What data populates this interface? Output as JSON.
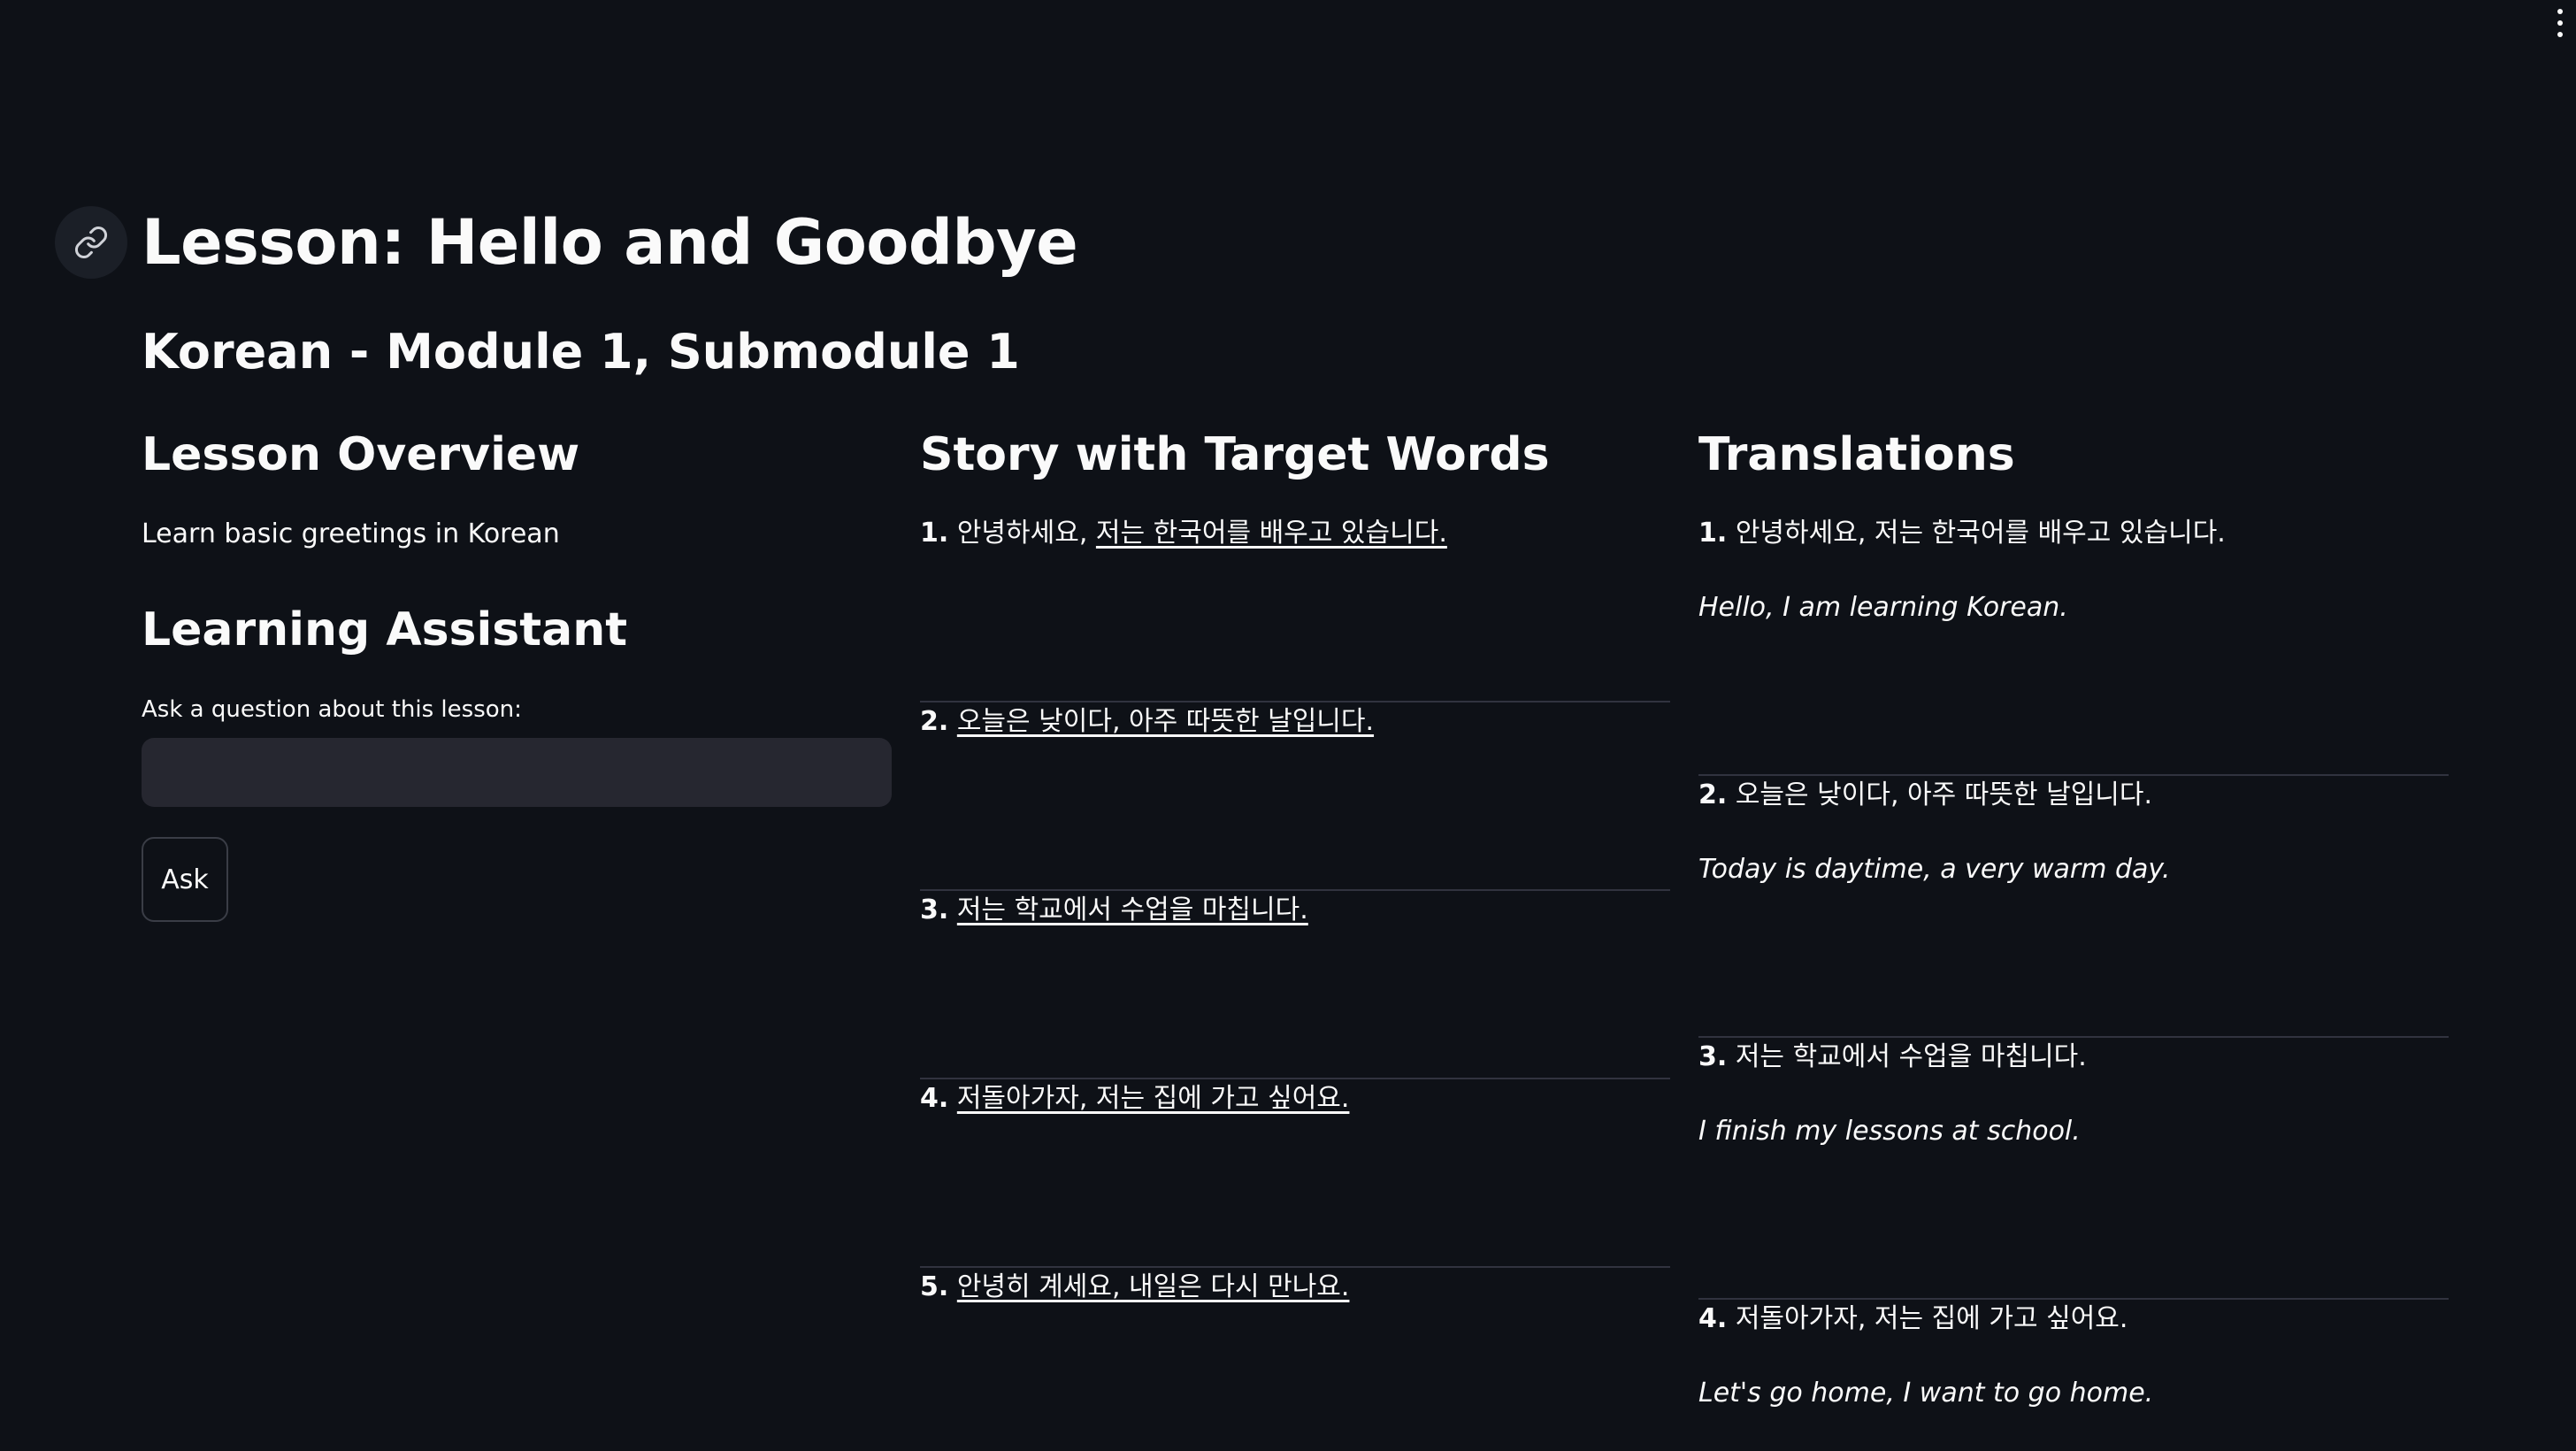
{
  "menu": {
    "icon": "vertical-ellipsis-icon"
  },
  "header": {
    "anchor_icon": "link-icon",
    "title": "Lesson: Hello and Goodbye",
    "subtitle": "Korean - Module 1, Submodule 1"
  },
  "overview": {
    "heading": "Lesson Overview",
    "text": "Learn basic greetings in Korean"
  },
  "assistant": {
    "heading": "Learning Assistant",
    "input_label": "Ask a question about this lesson:",
    "input_value": "",
    "button_label": "Ask"
  },
  "story": {
    "heading": "Story with Target Words",
    "items": [
      {
        "number": "1.",
        "plain": "안녕하세요, ",
        "underlined": "저는 한국어를 배우고 있습니다."
      },
      {
        "number": "2.",
        "plain": "",
        "underlined": "오늘은 낮이다, 아주 따뜻한 날입니다."
      },
      {
        "number": "3.",
        "plain": "",
        "underlined": "저는 학교에서 수업을 마칩니다."
      },
      {
        "number": "4.",
        "plain": "",
        "underlined": "저돌아가자, 저는 집에 가고 싶어요."
      },
      {
        "number": "5.",
        "plain": "",
        "underlined": "안녕히 계세요, 내일은 다시 만나요."
      }
    ]
  },
  "translations": {
    "heading": "Translations",
    "items": [
      {
        "number": "1.",
        "korean": "안녕하세요, 저는 한국어를 배우고 있습니다.",
        "english": "Hello, I am learning Korean."
      },
      {
        "number": "2.",
        "korean": "오늘은 낮이다, 아주 따뜻한 날입니다.",
        "english": "Today is daytime, a very warm day."
      },
      {
        "number": "3.",
        "korean": "저는 학교에서 수업을 마칩니다.",
        "english": "I finish my lessons at school."
      },
      {
        "number": "4.",
        "korean": "저돌아가자, 저는 집에 가고 싶어요.",
        "english": "Let's go home, I want to go home."
      }
    ]
  }
}
